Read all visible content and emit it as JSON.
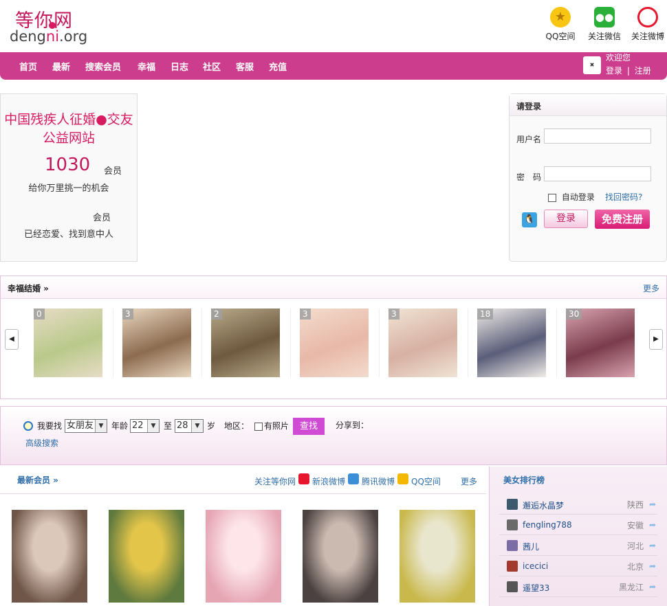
{
  "logo": {
    "main": "等你网",
    "sub_a": "deng",
    "sub_b": "ni",
    "sub_c": ".org"
  },
  "top_links": [
    {
      "label": "QQ空间",
      "icon": "qzone-star-icon"
    },
    {
      "label": "关注微信",
      "icon": "wechat-icon"
    },
    {
      "label": "关注微博",
      "icon": "weibo-icon"
    }
  ],
  "nav": {
    "items": [
      "首页",
      "最新",
      "搜索会员",
      "幸福",
      "日志",
      "社区",
      "客服",
      "充值"
    ],
    "welcome": "欢迎您",
    "login": "登录",
    "sep": "|",
    "register": "注册"
  },
  "intro": {
    "title": "中国残疾人征婚●交友公益网站",
    "member_count": "1030",
    "member_unit": "会员",
    "line1": "给你万里挑一的机会",
    "member_unit2": "会员",
    "line2": "已经恋爱、找到意中人"
  },
  "login": {
    "title": "请登录",
    "username_label": "用户名",
    "password_label": "密　码",
    "auto_login": "自动登录",
    "forgot": "找回密码?",
    "login_btn": "登录",
    "register_btn": "免费注册"
  },
  "happy": {
    "title": "幸福结婚 »",
    "more": "更多",
    "prev": "◀",
    "next": "▶",
    "photos": [
      {
        "badge": "0",
        "c1": "#b9c98a",
        "c2": "#e7dcc6"
      },
      {
        "badge": "3",
        "c1": "#8c6b4f",
        "c2": "#e9d7c0"
      },
      {
        "badge": "2",
        "c1": "#6e5a3f",
        "c2": "#b8a98a"
      },
      {
        "badge": "3",
        "c1": "#e8b8a8",
        "c2": "#f3dccd"
      },
      {
        "badge": "3",
        "c1": "#d7b0a3",
        "c2": "#f0e4d4"
      },
      {
        "badge": "18",
        "c1": "#5b5e7a",
        "c2": "#f1ede8"
      },
      {
        "badge": "30",
        "c1": "#7a3c4c",
        "c2": "#d9a3b0"
      }
    ]
  },
  "search": {
    "i_want": "我要找",
    "gender": "女朋友",
    "age_label": "年龄",
    "age_from": "22",
    "to": "至",
    "age_to": "28",
    "age_unit": "岁",
    "region": "地区：",
    "has_photo": "有照片",
    "find_btn": "查找",
    "share": "分享到：",
    "advanced": "高级搜索"
  },
  "members": {
    "title": "最新会员 »",
    "follow": "关注等你网",
    "sina": "新浪微博",
    "tencent": "腾讯微博",
    "qzone": "QQ空间",
    "more": "更多",
    "people": [
      {
        "name": "",
        "c1": "#6f5648",
        "c2": "#dcc7bb"
      },
      {
        "name": "",
        "c1": "#5f7a3e",
        "c2": "#e3c54a"
      },
      {
        "name": "",
        "c1": "#e6a5b3",
        "c2": "#fde5ea"
      },
      {
        "name": "",
        "c1": "#4b4140",
        "c2": "#cbbab0"
      },
      {
        "name": "",
        "c1": "#c9b94c",
        "c2": "#e9e6ce"
      }
    ]
  },
  "rank": {
    "title": "美女排行榜",
    "rows": [
      {
        "name": "邂逅水晶梦",
        "loc": "陕西",
        "c": "#3b5a6e"
      },
      {
        "name": "fengling788",
        "loc": "安徽",
        "c": "#6a6a6a"
      },
      {
        "name": "茜儿",
        "loc": "河北",
        "c": "#7b6ca5"
      },
      {
        "name": "icecici",
        "loc": "北京",
        "c": "#a33a2e"
      },
      {
        "name": "遥望33",
        "loc": "黑龙江",
        "c": "#555555"
      }
    ]
  }
}
